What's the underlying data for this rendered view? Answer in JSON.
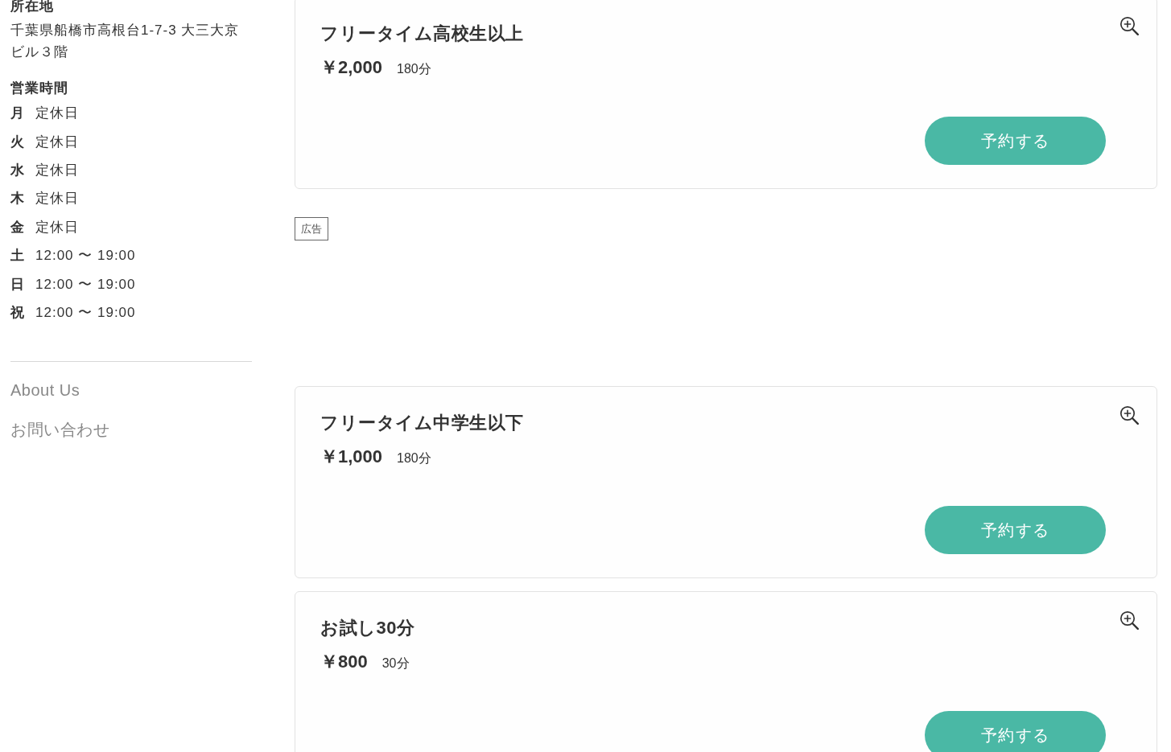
{
  "sidebar": {
    "location": {
      "heading": "所在地",
      "address": "千葉県船橋市高根台1-7-3 大三大京ビル３階"
    },
    "hours": {
      "heading": "営業時間",
      "rows": [
        {
          "day": "月",
          "time": "定休日"
        },
        {
          "day": "火",
          "time": "定休日"
        },
        {
          "day": "水",
          "time": "定休日"
        },
        {
          "day": "木",
          "time": "定休日"
        },
        {
          "day": "金",
          "time": "定休日"
        },
        {
          "day": "土",
          "time": "12:00 〜 19:00"
        },
        {
          "day": "日",
          "time": "12:00 〜 19:00"
        },
        {
          "day": "祝",
          "time": "12:00 〜 19:00"
        }
      ]
    },
    "links": [
      "About Us",
      "お問い合わせ"
    ]
  },
  "main": [
    {
      "kind": "plan",
      "title": "フリータイム高校生以上",
      "price": "￥2,000",
      "duration": "180分",
      "button": "予約する"
    },
    {
      "kind": "ad",
      "label": "広告"
    },
    {
      "kind": "plan",
      "title": "フリータイム中学生以下",
      "price": "￥1,000",
      "duration": "180分",
      "button": "予約する"
    },
    {
      "kind": "plan",
      "title": "お試し30分",
      "price": "￥800",
      "duration": "30分",
      "button": "予約する"
    }
  ]
}
